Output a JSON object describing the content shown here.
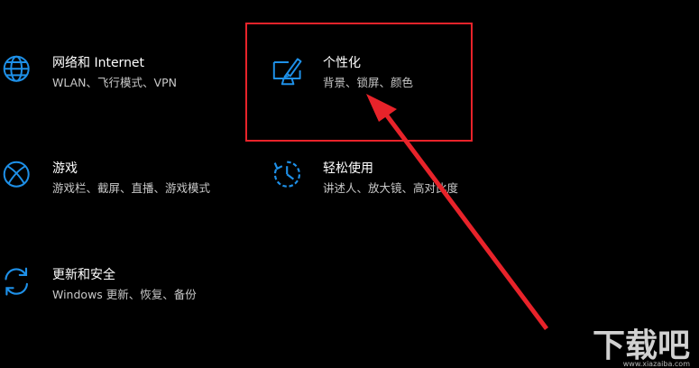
{
  "accent_color": "#1e90e8",
  "highlight_color": "#e8232a",
  "tiles": [
    {
      "title": "网络和 Internet",
      "subtitle": "WLAN、飞行模式、VPN",
      "icon": "globe-icon"
    },
    {
      "title": "个性化",
      "subtitle": "背景、锁屏、颜色",
      "icon": "personalization-icon"
    },
    {
      "title": "游戏",
      "subtitle": "游戏栏、截屏、直播、游戏模式",
      "icon": "xbox-icon"
    },
    {
      "title": "轻松使用",
      "subtitle": "讲述人、放大镜、高对比度",
      "icon": "ease-of-access-icon"
    },
    {
      "title": "更新和安全",
      "subtitle": "Windows 更新、恢复、备份",
      "icon": "update-icon"
    }
  ],
  "watermark": {
    "text": "下载吧",
    "url": "www.xiazaiba.com"
  }
}
